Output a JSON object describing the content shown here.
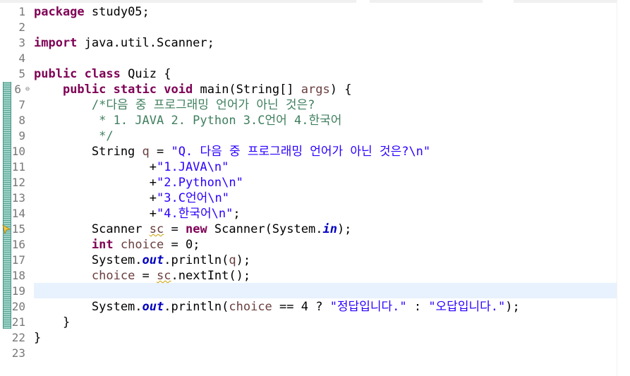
{
  "editor": {
    "lines": [
      {
        "n": "1",
        "code": "package study05;"
      },
      {
        "n": "2",
        "code": ""
      },
      {
        "n": "3",
        "code": "import java.util.Scanner;"
      },
      {
        "n": "4",
        "code": ""
      },
      {
        "n": "5",
        "code": "public class Quiz {"
      },
      {
        "n": "6",
        "code": "    public static void main(String[] args) {"
      },
      {
        "n": "7",
        "code": "        /*다음 중 프로그래밍 언어가 아닌 것은?"
      },
      {
        "n": "8",
        "code": "         * 1. JAVA 2. Python 3.C언어 4.한국어"
      },
      {
        "n": "9",
        "code": "         */"
      },
      {
        "n": "10",
        "code": "        String q = \"Q. 다음 중 프로그래밍 언어가 아닌 것은?\\n\""
      },
      {
        "n": "11",
        "code": "                +\"1.JAVA\\n\""
      },
      {
        "n": "12",
        "code": "                +\"2.Python\\n\""
      },
      {
        "n": "13",
        "code": "                +\"3.C언어\\n\""
      },
      {
        "n": "14",
        "code": "                +\"4.한국어\\n\";"
      },
      {
        "n": "15",
        "code": "        Scanner sc = new Scanner(System.in);"
      },
      {
        "n": "16",
        "code": "        int choice = 0;"
      },
      {
        "n": "17",
        "code": "        System.out.println(q);"
      },
      {
        "n": "18",
        "code": "        choice = sc.nextInt();"
      },
      {
        "n": "19",
        "code": ""
      },
      {
        "n": "20",
        "code": "        System.out.println(choice == 4 ? \"정답입니다.\" : \"오답입니다.\");"
      },
      {
        "n": "21",
        "code": "    }"
      },
      {
        "n": "22",
        "code": "}"
      },
      {
        "n": "23",
        "code": ""
      }
    ],
    "fold_marker_line": "6",
    "warning_line": "15",
    "current_line": "19"
  },
  "colors": {
    "keyword": "#7f0055",
    "string": "#2a00ff",
    "comment": "#3f7f5f",
    "static_field": "#0000c0",
    "local_var": "#6a3e3e",
    "current_line_bg": "#e8f2fe",
    "line_number": "#787878"
  }
}
